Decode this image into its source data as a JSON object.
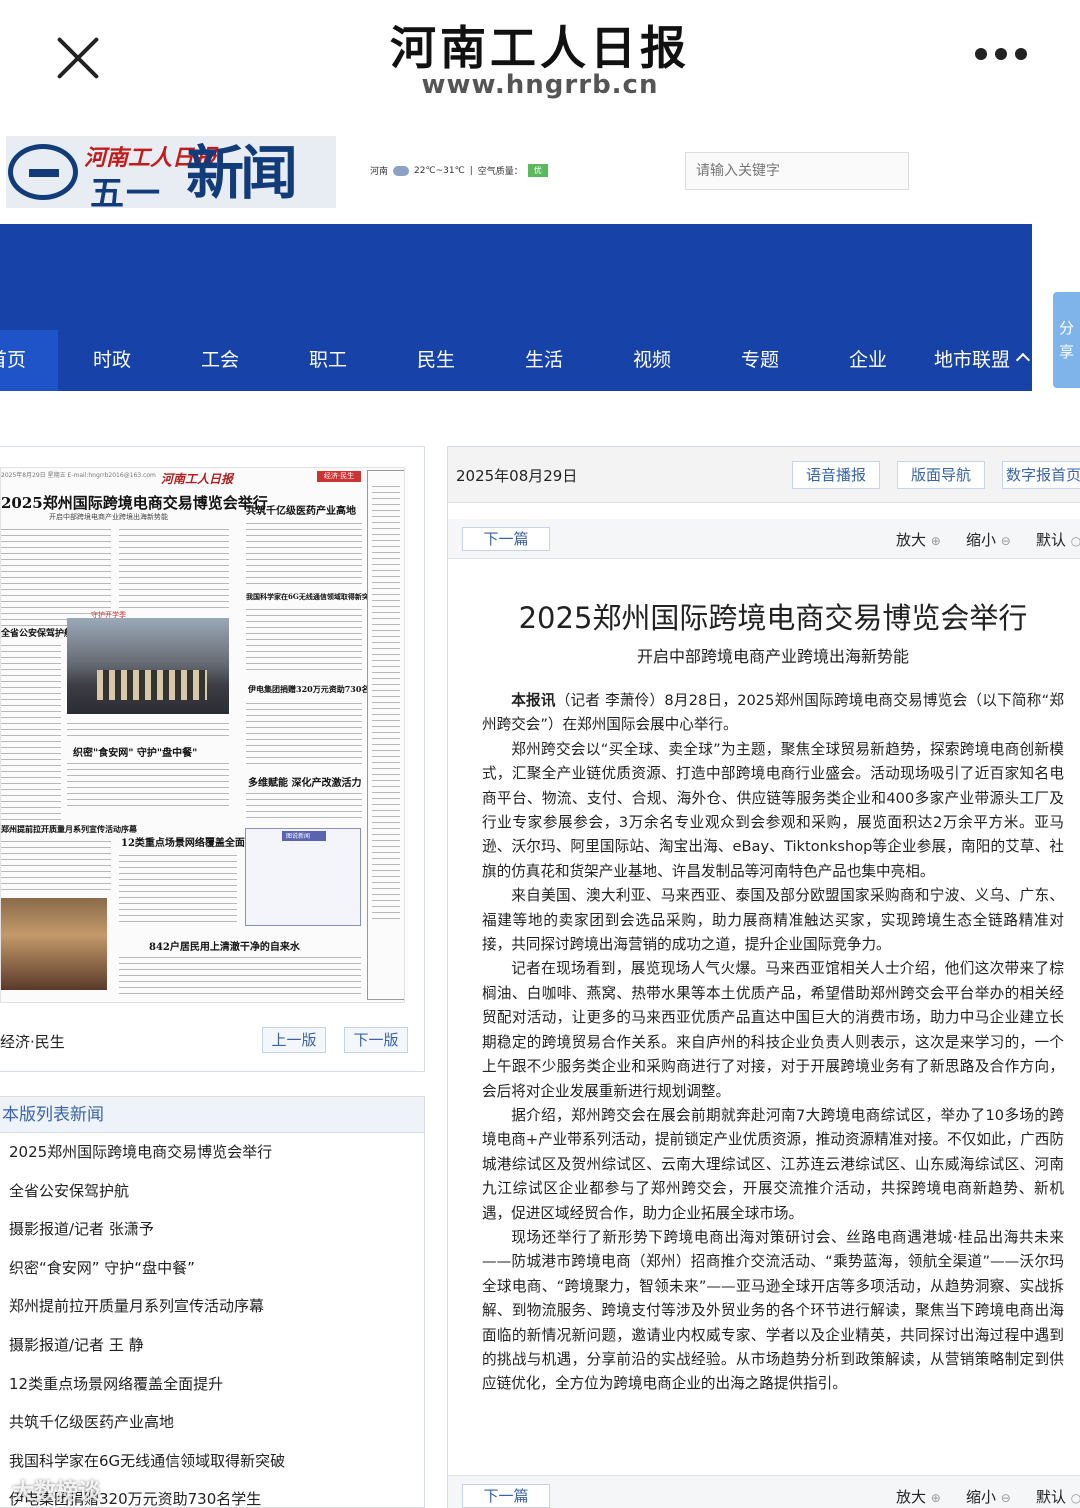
{
  "app": {
    "title": "河南工人日报",
    "url": "www.hngrrb.cn"
  },
  "site": {
    "logo_red_text": "河南工人日报",
    "logo_five": "五一",
    "logo_news": "新闻网",
    "weather_city": "河南",
    "weather_temp": "22℃~31℃",
    "weather_sep": "|",
    "air_label": "空气质量：",
    "air_value": "优",
    "search_placeholder": "请输入关键字"
  },
  "nav": {
    "items": [
      "首页",
      "时政",
      "工会",
      "职工",
      "民生",
      "生活",
      "视频",
      "专题",
      "企业",
      "地市联盟"
    ],
    "share": "分享"
  },
  "left": {
    "paper": {
      "masthead": "2025年8月29日  星期五  E-mail:hngrrb2016@163.com",
      "paper_name": "河南工人日报",
      "edition_tag": "经济·民生",
      "headline1": "2025郑州国际跨境电商交易博览会举行",
      "subhead1": "开启中部跨境电商产业跨境出海新势能",
      "headline2": "共筑千亿级医药产业高地",
      "headline3": "我国科学家在6G无线通信领域取得新突破",
      "section_caption": "守护开学季",
      "headline4": "全省公安保驾护航",
      "headline5": "伊电集团捐赠320万元资助730名学生",
      "headline6": "织密\"食安网\"  守护\"盘中餐\"",
      "headline7": "多维赋能  深化产改激活力",
      "headline8": "郑州提前拉开质量月系列宣传活动序幕",
      "headline9": "12类重点场景网络覆盖全面提升",
      "headline10": "842户居民用上清澈干净的自来水",
      "ad_title": "图说新闻"
    },
    "edition_label": "经济·民生",
    "prev_edition": "上一版",
    "next_edition": "下一版",
    "list_title": "本版列表新闻",
    "list": [
      "2025郑州国际跨境电商交易博览会举行",
      "全省公安保驾护航",
      "摄影报道/记者 张潇予",
      "织密“食安网” 守护“盘中餐”",
      "郑州提前拉开质量月系列宣传活动序幕",
      "摄影报道/记者 王 静",
      "12类重点场景网络覆盖全面提升",
      "共筑千亿级医药产业高地",
      "我国科学家在6G无线通信领域取得新突破",
      "伊电集团捐赠320万元资助730名学生"
    ]
  },
  "right": {
    "date": "2025年08月29日",
    "buttons": {
      "voice": "语音播报",
      "layout_nav": "版面导航",
      "digital_home": "数字报首页"
    },
    "toolbar": {
      "next": "下一篇",
      "zoom_in": "放大",
      "zoom_out": "缩小",
      "default": "默认"
    },
    "article": {
      "title": "2025郑州国际跨境电商交易博览会举行",
      "subtitle": "开启中部跨境电商产业跨境出海新势能",
      "lead_bold": "本报讯",
      "paragraphs": [
        "（记者 李萧伶）8月28日，2025郑州国际跨境电商交易博览会（以下简称“郑州跨交会”）在郑州国际会展中心举行。",
        "郑州跨交会以“买全球、卖全球”为主题，聚焦全球贸易新趋势，探索跨境电商创新模式，汇聚全产业链优质资源、打造中部跨境电商行业盛会。活动现场吸引了近百家知名电商平台、物流、支付、合规、海外仓、供应链等服务类企业和400多家产业带源头工厂及行业专家参展参会，3万余名专业观众到会参观和采购，展览面积达2万余平方米。亚马逊、沃尔玛、阿里国际站、淘宝出海、eBay、Tiktonkshop等企业参展，南阳的艾草、社旗的仿真花和货架产业基地、许昌发制品等河南特色产品也集中亮相。",
        "来自美国、澳大利亚、马来西亚、泰国及部分欧盟国家采购商和宁波、义乌、广东、福建等地的卖家团到会选品采购，助力展商精准触达买家，实现跨境生态全链路精准对接，共同探讨跨境出海营销的成功之道，提升企业国际竞争力。",
        "记者在现场看到，展览现场人气火爆。马来西亚馆相关人士介绍，他们这次带来了棕榈油、白咖啡、燕窝、热带水果等本土优质产品，希望借助郑州跨交会平台举办的相关经贸配对活动，让更多的马来西亚优质产品直达中国巨大的消费市场，助力中马企业建立长期稳定的跨境贸易合作关系。来自庐州的科技企业负责人则表示，这次是来学习的，一个上午跟不少服务类企业和采购商进行了对接，对于开展跨境业务有了新思路及合作方向，会后将对企业发展重新进行规划调整。",
        "据介绍，郑州跨交会在展会前期就奔赴河南7大跨境电商综试区，举办了10多场的跨境电商+产业带系列活动，提前锁定产业优质资源，推动资源精准对接。不仅如此，广西防城港综试区及贺州综试区、云南大理综试区、江苏连云港综试区、山东威海综试区、河南九江综试区企业都参与了郑州跨交会，开展交流推介活动，共探跨境电商新趋势、新机遇，促进区域经贸合作，助力企业拓展全球市场。",
        "现场还举行了新形势下跨境电商出海对策研讨会、丝路电商遇港城·桂品出海共未来——防城港市跨境电商（郑州）招商推介交流活动、“乘势蓝海，领航全渠道”——沃尔玛全球电商、“跨境聚力，智领未来”——亚马逊全球开店等多项活动，从趋势洞察、实战拆解、到物流服务、跨境支付等涉及外贸业务的各个环节进行解读，聚焦当下跨境电商出海面临的新情况新问题，邀请业内权威专家、学者以及企业精英，共同探讨出海过程中遇到的挑战与机遇，分享前沿的实战经验。从市场趋势分析到政策解读，从营销策略制定到供应链优化，全方位为跨境电商企业的出海之路提供指引。"
      ]
    }
  },
  "watermark": "大数榜谈"
}
